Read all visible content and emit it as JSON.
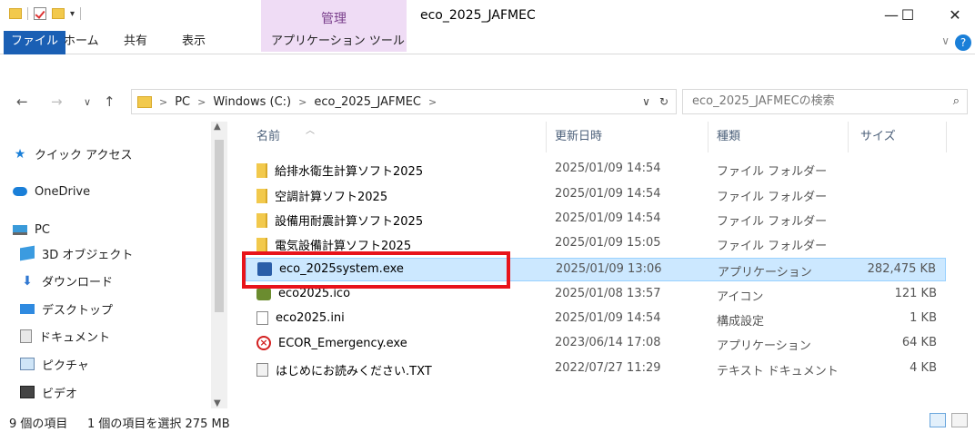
{
  "titlebar": {
    "context_tab": "管理",
    "title": "eco_2025_JAFMEC",
    "minimize": "—",
    "maximize": "☐",
    "close": "✕"
  },
  "ribbon": {
    "tabs": [
      "ファイル",
      "ホーム",
      "共有",
      "表示",
      "アプリケーション ツール"
    ],
    "help": "?"
  },
  "address": {
    "back": "←",
    "forward": "→",
    "recent": "∨",
    "up": "↑",
    "crumbs": [
      "PC",
      "Windows (C:)",
      "eco_2025_JAFMEC"
    ],
    "separator": ">",
    "refresh": "↻",
    "search_placeholder": "eco_2025_JAFMECの検索"
  },
  "nav": {
    "items": [
      {
        "label": "クイック アクセス",
        "icon": "star-icon"
      },
      {
        "label": "OneDrive",
        "icon": "cloud-icon"
      },
      {
        "label": "PC",
        "icon": "pc-icon"
      },
      {
        "label": "3D オブジェクト",
        "icon": "cube-icon"
      },
      {
        "label": "ダウンロード",
        "icon": "download-icon"
      },
      {
        "label": "デスクトップ",
        "icon": "desktop-icon"
      },
      {
        "label": "ドキュメント",
        "icon": "document-icon"
      },
      {
        "label": "ピクチャ",
        "icon": "picture-icon"
      },
      {
        "label": "ビデオ",
        "icon": "video-icon"
      }
    ]
  },
  "list": {
    "columns": [
      "名前",
      "更新日時",
      "種類",
      "サイズ"
    ],
    "rows": [
      {
        "name": "給排水衛生計算ソフト2025",
        "date": "2025/01/09 14:54",
        "type": "ファイル フォルダー",
        "size": "",
        "icon": "folder-icon"
      },
      {
        "name": "空調計算ソフト2025",
        "date": "2025/01/09 14:54",
        "type": "ファイル フォルダー",
        "size": "",
        "icon": "folder-icon"
      },
      {
        "name": "設備用耐震計算ソフト2025",
        "date": "2025/01/09 14:54",
        "type": "ファイル フォルダー",
        "size": "",
        "icon": "folder-icon"
      },
      {
        "name": "電気設備計算ソフト2025",
        "date": "2025/01/09 15:05",
        "type": "ファイル フォルダー",
        "size": "",
        "icon": "folder-icon"
      },
      {
        "name": "eco_2025system.exe",
        "date": "2025/01/09 13:06",
        "type": "アプリケーション",
        "size": "282,475 KB",
        "icon": "exe-icon",
        "selected": true
      },
      {
        "name": "eco2025.ico",
        "date": "2025/01/08 13:57",
        "type": "アイコン",
        "size": "121 KB",
        "icon": "ico-file-icon"
      },
      {
        "name": "eco2025.ini",
        "date": "2025/01/09 14:54",
        "type": "構成設定",
        "size": "1 KB",
        "icon": "settings-file-icon"
      },
      {
        "name": "ECOR_Emergency.exe",
        "date": "2023/06/14 17:08",
        "type": "アプリケーション",
        "size": "64 KB",
        "icon": "error-icon"
      },
      {
        "name": "はじめにお読みください.TXT",
        "date": "2022/07/27 11:29",
        "type": "テキスト ドキュメント",
        "size": "4 KB",
        "icon": "text-file-icon"
      }
    ]
  },
  "status": {
    "count": "9 個の項目",
    "selection": "1 個の項目を選択 275 MB"
  }
}
